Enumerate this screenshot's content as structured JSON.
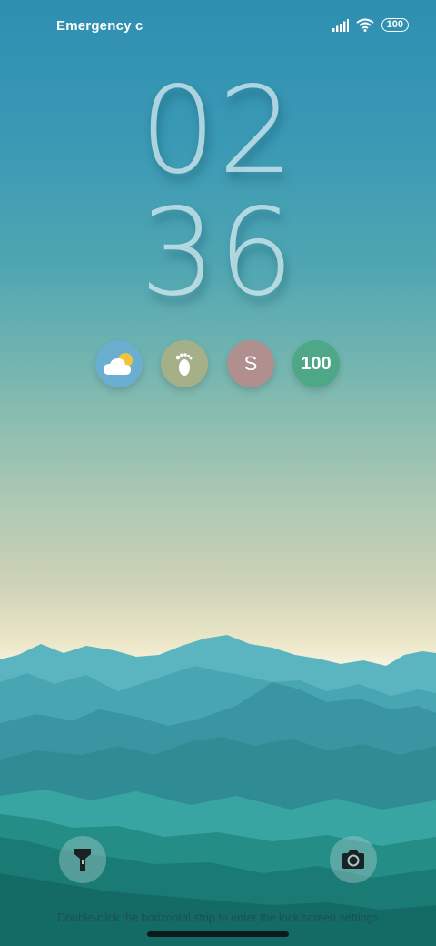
{
  "status_bar": {
    "carrier_text": "Emergency c",
    "battery": "100",
    "signal_icon": "signal-icon",
    "wifi_icon": "wifi-icon"
  },
  "clock": {
    "hours": "02",
    "minutes": "36"
  },
  "widgets": {
    "weather_icon": "weather-cloud-sun-icon",
    "steps_icon": "footprint-icon",
    "s_label": "S",
    "battery_label": "100"
  },
  "actions": {
    "flashlight_icon": "flashlight-icon",
    "camera_icon": "camera-icon"
  },
  "hint": "Double-click the horizontal strip to enter the lock screen settings"
}
